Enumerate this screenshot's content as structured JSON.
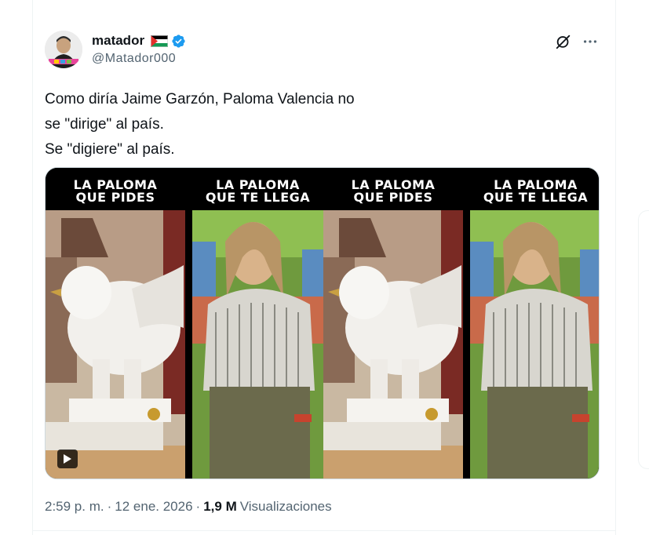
{
  "tweet": {
    "display_name": "matador",
    "handle": "@Matador000",
    "text_lines": [
      "Como diría Jaime Garzón, Paloma Valencia no",
      "se \"dirige\" al país.",
      "Se \"digiere\" al país."
    ],
    "time": "2:59 p. m.",
    "date": "12 ene. 2026",
    "dot": "·",
    "views_count": "1,9 M",
    "views_label": "Visualizaciones"
  },
  "media": {
    "left_label_line1": "LA PALOMA",
    "left_label_line2": "QUE PIDES",
    "right_label_line1": "LA PALOMA",
    "right_label_line2": "QUE TE LLEGA"
  },
  "icons": {
    "verified": "verified-badge-icon",
    "grok": "grok-icon",
    "more": "more-icon",
    "play": "play-icon",
    "flag": "palestine-flag-icon"
  },
  "colors": {
    "text_primary": "#0f1419",
    "text_secondary": "#536471",
    "verified_blue": "#1d9bf0",
    "border": "#eff3f4"
  }
}
